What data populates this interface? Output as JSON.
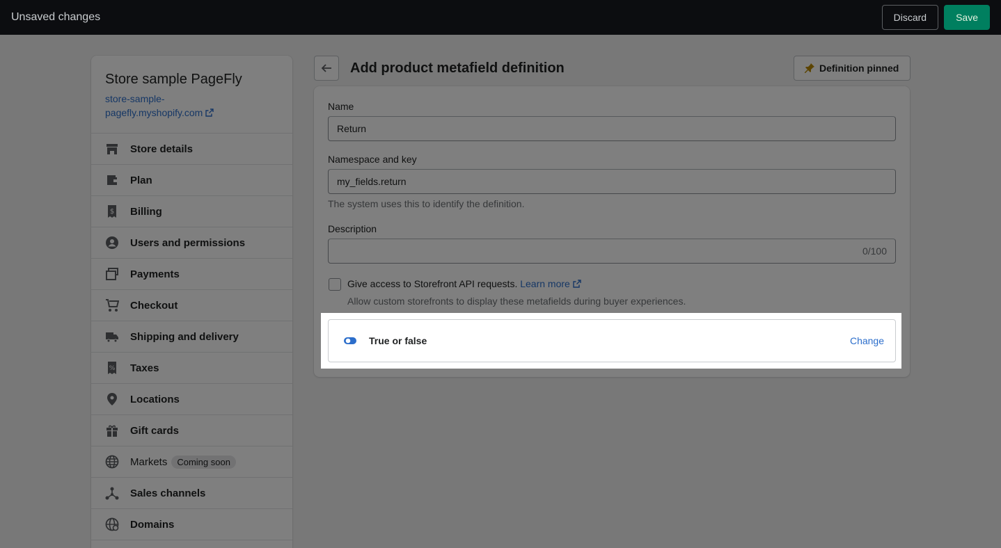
{
  "topbar": {
    "title": "Unsaved changes",
    "discard_label": "Discard",
    "save_label": "Save"
  },
  "sidebar": {
    "store_name": "Store sample PageFly",
    "store_url": "store-sample-pagefly.myshopify.com",
    "items": [
      {
        "label": "Store details",
        "icon": "store-icon"
      },
      {
        "label": "Plan",
        "icon": "wallet-icon"
      },
      {
        "label": "Billing",
        "icon": "billing-icon"
      },
      {
        "label": "Users and permissions",
        "icon": "user-icon"
      },
      {
        "label": "Payments",
        "icon": "payments-icon"
      },
      {
        "label": "Checkout",
        "icon": "cart-icon"
      },
      {
        "label": "Shipping and delivery",
        "icon": "truck-icon"
      },
      {
        "label": "Taxes",
        "icon": "tax-icon"
      },
      {
        "label": "Locations",
        "icon": "location-icon"
      },
      {
        "label": "Gift cards",
        "icon": "gift-icon"
      },
      {
        "label": "Markets",
        "icon": "globe-icon",
        "badge": "Coming soon"
      },
      {
        "label": "Sales channels",
        "icon": "channels-icon"
      },
      {
        "label": "Domains",
        "icon": "domain-icon"
      }
    ]
  },
  "main": {
    "title": "Add product metafield definition",
    "pin_label": "Definition pinned",
    "name_label": "Name",
    "name_value": "Return",
    "key_label": "Namespace and key",
    "key_value": "my_fields.return",
    "key_help": "The system uses this to identify the definition.",
    "description_label": "Description",
    "description_counter": "0/100",
    "storefront_label": "Give access to Storefront API requests.",
    "learn_more": "Learn more",
    "storefront_help": "Allow custom storefronts to display these metafields during buyer experiences.",
    "type_label": "True or false",
    "change_label": "Change"
  },
  "colors": {
    "accent": "#2c6ecb",
    "save": "#007f5f",
    "topbar": "#0c0d10"
  }
}
